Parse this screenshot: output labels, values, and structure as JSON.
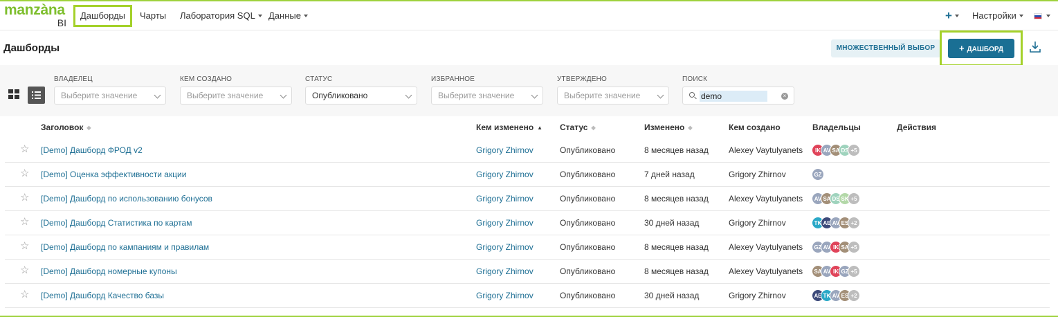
{
  "nav": {
    "logo_word": "manzàna",
    "logo_suffix": "BI",
    "items": [
      {
        "label": "Дашборды"
      },
      {
        "label": "Чарты"
      },
      {
        "label": "Лаборатория SQL"
      },
      {
        "label": "Данные"
      }
    ],
    "plus": "+",
    "settings": "Настройки"
  },
  "header": {
    "title": "Дашборды",
    "multi_select": "МНОЖЕСТВЕННЫЙ ВЫБОР",
    "new_dashboard": "ДАШБОРД",
    "new_plus": "+"
  },
  "filters": [
    {
      "label": "ВЛАДЕЛЕЦ",
      "value": "Выберите значение",
      "filled": false
    },
    {
      "label": "КЕМ СОЗДАНО",
      "value": "Выберите значение",
      "filled": false
    },
    {
      "label": "СТАТУС",
      "value": "Опубликовано",
      "filled": true
    },
    {
      "label": "ИЗБРАННОЕ",
      "value": "Выберите значение",
      "filled": false
    },
    {
      "label": "УТВЕРЖДЕНО",
      "value": "Выберите значение",
      "filled": false
    }
  ],
  "search": {
    "label": "ПОИСК",
    "value": "demo"
  },
  "table": {
    "headers": {
      "title": "Заголовок",
      "modified_by": "Кем изменено",
      "status": "Статус",
      "modified": "Изменено",
      "created_by": "Кем создано",
      "owners": "Владельцы",
      "actions": "Действия"
    },
    "rows": [
      {
        "title": "[Demo] Дашборд ФРОД v2",
        "modified_by": "Grigory Zhirnov",
        "status": "Опубликовано",
        "modified": "8 месяцев назад",
        "created_by": "Alexey Vaytulyanets",
        "owners": [
          {
            "i": "IK",
            "c": "#e0445a"
          },
          {
            "i": "AV",
            "c": "#9aa6bd"
          },
          {
            "i": "SA",
            "c": "#a38f78"
          },
          {
            "i": "DS",
            "c": "#9fd3bd"
          },
          {
            "i": "+5",
            "c": "#bdbdbd"
          }
        ]
      },
      {
        "title": "[Demo] Оценка эффективности акции",
        "modified_by": "Grigory Zhirnov",
        "status": "Опубликовано",
        "modified": "7 дней назад",
        "created_by": "Grigory Zhirnov",
        "owners": [
          {
            "i": "GZ",
            "c": "#9aa6bd"
          }
        ]
      },
      {
        "title": "[Demo] Дашборд по использованию бонусов",
        "modified_by": "Grigory Zhirnov",
        "status": "Опубликовано",
        "modified": "8 месяцев назад",
        "created_by": "Alexey Vaytulyanets",
        "owners": [
          {
            "i": "AV",
            "c": "#9aa6bd"
          },
          {
            "i": "SA",
            "c": "#a38f78"
          },
          {
            "i": "DS",
            "c": "#9fd3bd"
          },
          {
            "i": "SK",
            "c": "#b3d8a8"
          },
          {
            "i": "+5",
            "c": "#bdbdbd"
          }
        ]
      },
      {
        "title": "[Demo] Дашборд Статистика по картам",
        "modified_by": "Grigory Zhirnov",
        "status": "Опубликовано",
        "modified": "30 дней назад",
        "created_by": "Grigory Zhirnov",
        "owners": [
          {
            "i": "TK",
            "c": "#2aa8c7"
          },
          {
            "i": "AE",
            "c": "#3d4a7a"
          },
          {
            "i": "AV",
            "c": "#9aa6bd"
          },
          {
            "i": "ES",
            "c": "#a38f78"
          },
          {
            "i": "+2",
            "c": "#bdbdbd"
          }
        ]
      },
      {
        "title": "[Demo] Дашборд по кампаниям и правилам",
        "modified_by": "Grigory Zhirnov",
        "status": "Опубликовано",
        "modified": "8 месяцев назад",
        "created_by": "Alexey Vaytulyanets",
        "owners": [
          {
            "i": "GZ",
            "c": "#9aa6bd"
          },
          {
            "i": "AV",
            "c": "#9aa6bd"
          },
          {
            "i": "IK",
            "c": "#e0445a"
          },
          {
            "i": "SA",
            "c": "#a38f78"
          },
          {
            "i": "+5",
            "c": "#bdbdbd"
          }
        ]
      },
      {
        "title": "[Demo] Дашборд номерные купоны",
        "modified_by": "Grigory Zhirnov",
        "status": "Опубликовано",
        "modified": "8 месяцев назад",
        "created_by": "Alexey Vaytulyanets",
        "owners": [
          {
            "i": "SA",
            "c": "#a38f78"
          },
          {
            "i": "AV",
            "c": "#9aa6bd"
          },
          {
            "i": "IK",
            "c": "#e0445a"
          },
          {
            "i": "GZ",
            "c": "#9aa6bd"
          },
          {
            "i": "+5",
            "c": "#bdbdbd"
          }
        ]
      },
      {
        "title": "[Demo] Дашборд Качество базы",
        "modified_by": "Grigory Zhirnov",
        "status": "Опубликовано",
        "modified": "30 дней назад",
        "created_by": "Grigory Zhirnov",
        "owners": [
          {
            "i": "AE",
            "c": "#3d4a7a"
          },
          {
            "i": "TK",
            "c": "#2aa8c7"
          },
          {
            "i": "AV",
            "c": "#9aa6bd"
          },
          {
            "i": "ES",
            "c": "#a38f78"
          },
          {
            "i": "+2",
            "c": "#bdbdbd"
          }
        ]
      }
    ]
  },
  "colors": {
    "brand_green": "#7dbe2c",
    "highlight": "#a4d12a",
    "primary": "#1a6f94",
    "link": "#1e6f94"
  }
}
